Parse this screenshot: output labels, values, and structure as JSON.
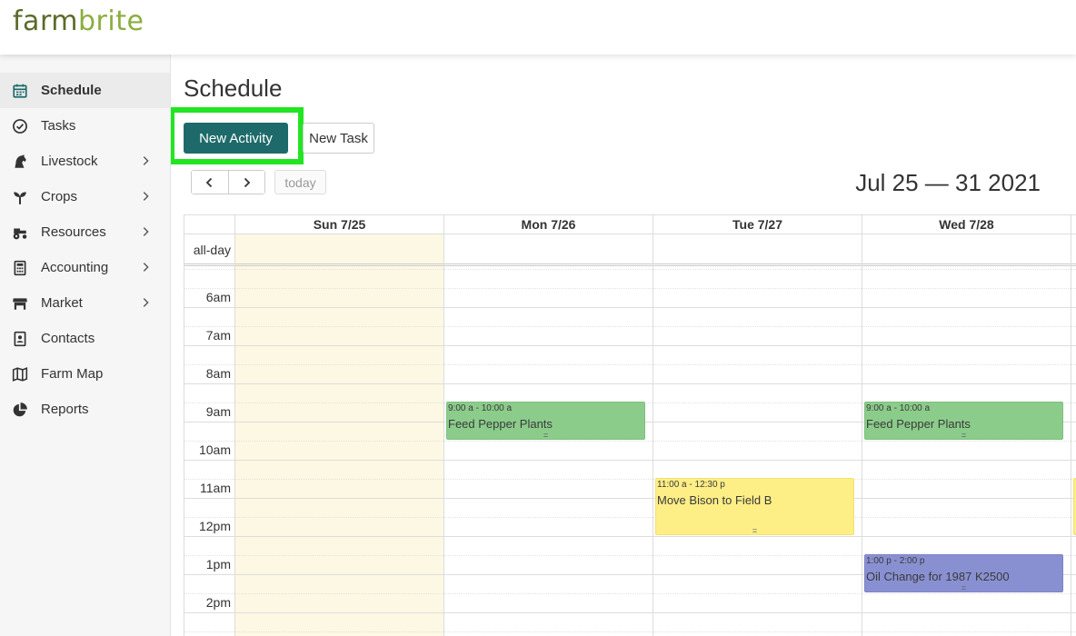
{
  "app": {
    "logo_part1": "farm",
    "logo_part2": "brite",
    "brand_dark": "#5a6b2a",
    "brand_light": "#8cad3f",
    "accent": "#1e6a6a"
  },
  "sidebar": {
    "items": [
      {
        "label": "Schedule",
        "icon": "calendar-icon",
        "active": true,
        "has_submenu": false
      },
      {
        "label": "Tasks",
        "icon": "check-circle-icon",
        "active": false,
        "has_submenu": false
      },
      {
        "label": "Livestock",
        "icon": "horse-icon",
        "active": false,
        "has_submenu": true
      },
      {
        "label": "Crops",
        "icon": "seedling-icon",
        "active": false,
        "has_submenu": true
      },
      {
        "label": "Resources",
        "icon": "tractor-icon",
        "active": false,
        "has_submenu": true
      },
      {
        "label": "Accounting",
        "icon": "calculator-icon",
        "active": false,
        "has_submenu": true
      },
      {
        "label": "Market",
        "icon": "store-icon",
        "active": false,
        "has_submenu": true
      },
      {
        "label": "Contacts",
        "icon": "address-book-icon",
        "active": false,
        "has_submenu": false
      },
      {
        "label": "Farm Map",
        "icon": "map-icon",
        "active": false,
        "has_submenu": false
      },
      {
        "label": "Reports",
        "icon": "pie-chart-icon",
        "active": false,
        "has_submenu": false
      }
    ]
  },
  "main": {
    "title": "Schedule",
    "new_activity_label": "New Activity",
    "new_task_label": "New Task",
    "today_label": "today",
    "date_range": "Jul 25 — 31 2021"
  },
  "calendar": {
    "days": [
      "Sun 7/25",
      "Mon 7/26",
      "Tue 7/27",
      "Wed 7/28"
    ],
    "all_day_label": "all-day",
    "time_labels": [
      "6am",
      "7am",
      "8am",
      "9am",
      "10am",
      "11am",
      "12pm",
      "1pm",
      "2pm"
    ],
    "events": [
      {
        "time": "9:00 a - 10:00 a",
        "title": "Feed Pepper Plants",
        "day": "Mon 7/26",
        "color": "green"
      },
      {
        "time": "9:00 a - 10:00 a",
        "title": "Feed Pepper Plants",
        "day": "Wed 7/28",
        "color": "green"
      },
      {
        "time": "11:00 a - 12:30 p",
        "title": "Move Bison to Field B",
        "day": "Tue 7/27",
        "color": "yellow"
      },
      {
        "time": "1:00 p - 2:00 p",
        "title": "Oil Change for 1987 K2500",
        "day": "Wed 7/28",
        "color": "blue"
      }
    ],
    "event_colors": {
      "green": "#8bcc8b",
      "yellow": "#fdee86",
      "blue": "#8990d2",
      "today_bg": "#fcf8e3"
    }
  }
}
